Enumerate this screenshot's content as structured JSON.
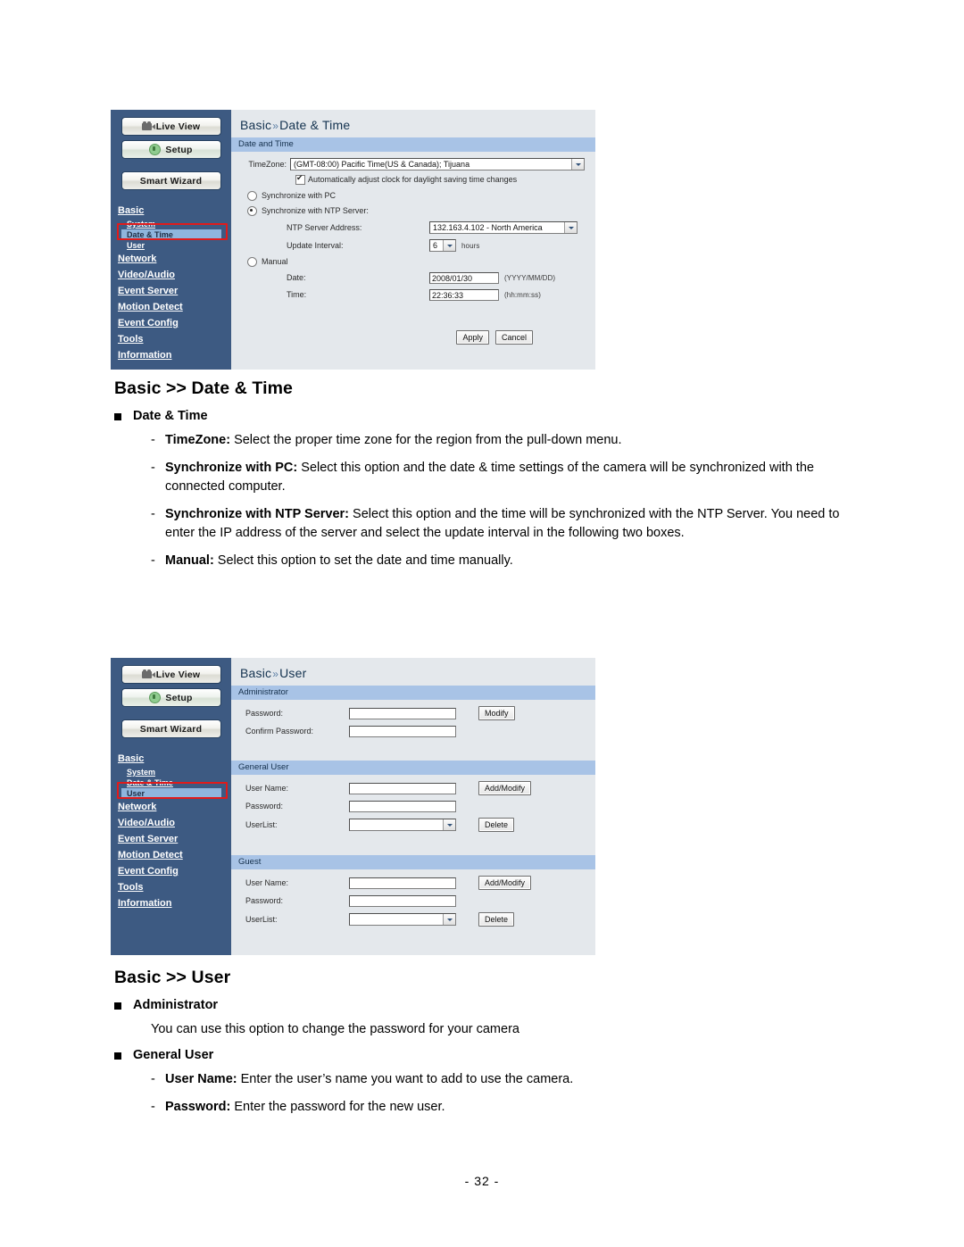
{
  "page": {
    "number_label": "- 32 -"
  },
  "screenshot_datetime": {
    "sidebar": {
      "buttons": [
        {
          "label": "Live View",
          "icon": "camera-icon"
        },
        {
          "label": "Setup",
          "icon": "gear-icon"
        },
        {
          "label": "Smart Wizard",
          "icon": "none"
        }
      ],
      "nav": [
        {
          "label": "Basic",
          "level": "top"
        },
        {
          "label": "System",
          "level": "sub"
        },
        {
          "label": "Date & Time",
          "level": "sub",
          "active": true
        },
        {
          "label": "User",
          "level": "sub"
        },
        {
          "label": "Network",
          "level": "top"
        },
        {
          "label": "Video/Audio",
          "level": "top"
        },
        {
          "label": "Event Server",
          "level": "top"
        },
        {
          "label": "Motion Detect",
          "level": "top"
        },
        {
          "label": "Event Config",
          "level": "top"
        },
        {
          "label": "Tools",
          "level": "top"
        },
        {
          "label": "Information",
          "level": "top"
        }
      ]
    },
    "title_prefix": "Basic",
    "title_chev": "»",
    "title_main": "Date & Time",
    "section_bar": "Date and Time",
    "timezone_label": "TimeZone:",
    "timezone_value": "(GMT-08:00) Pacific Time(US & Canada); Tijuana",
    "dst_checkbox_label": "Automatically adjust clock for daylight saving time changes",
    "dst_checked": true,
    "sync_pc_label": "Synchronize with PC",
    "sync_pc_selected": false,
    "sync_ntp_label": "Synchronize with NTP Server:",
    "sync_ntp_selected": true,
    "ntp_address_label": "NTP Server Address:",
    "ntp_address_value": "132.163.4.102 - North America",
    "update_interval_label": "Update Interval:",
    "update_interval_value": "6",
    "update_interval_unit": "hours",
    "manual_label": "Manual",
    "manual_selected": false,
    "date_label": "Date:",
    "date_value": "2008/01/30",
    "date_hint": "(YYYY/MM/DD)",
    "time_label": "Time:",
    "time_value": "22:36:33",
    "time_hint": "(hh:mm:ss)",
    "apply_label": "Apply",
    "cancel_label": "Cancel"
  },
  "screenshot_user": {
    "sidebar": {
      "buttons": [
        {
          "label": "Live View",
          "icon": "camera-icon"
        },
        {
          "label": "Setup",
          "icon": "gear-icon"
        },
        {
          "label": "Smart Wizard",
          "icon": "none"
        }
      ],
      "nav": [
        {
          "label": "Basic",
          "level": "top"
        },
        {
          "label": "System",
          "level": "sub"
        },
        {
          "label": "Date & Time",
          "level": "sub"
        },
        {
          "label": "User",
          "level": "sub",
          "active": true
        },
        {
          "label": "Network",
          "level": "top"
        },
        {
          "label": "Video/Audio",
          "level": "top"
        },
        {
          "label": "Event Server",
          "level": "top"
        },
        {
          "label": "Motion Detect",
          "level": "top"
        },
        {
          "label": "Event Config",
          "level": "top"
        },
        {
          "label": "Tools",
          "level": "top"
        },
        {
          "label": "Information",
          "level": "top"
        }
      ]
    },
    "title_prefix": "Basic",
    "title_chev": "»",
    "title_main": "User",
    "admin": {
      "bar": "Administrator",
      "password_label": "Password:",
      "password_value": "",
      "confirm_label": "Confirm Password:",
      "confirm_value": "",
      "modify_label": "Modify"
    },
    "general": {
      "bar": "General User",
      "username_label": "User Name:",
      "username_value": "",
      "password_label": "Password:",
      "password_value": "",
      "userlist_label": "UserList:",
      "userlist_value": "",
      "add_modify_label": "Add/Modify",
      "delete_label": "Delete"
    },
    "guest": {
      "bar": "Guest",
      "username_label": "User Name:",
      "username_value": "",
      "password_label": "Password:",
      "password_value": "",
      "userlist_label": "UserList:",
      "userlist_value": "",
      "add_modify_label": "Add/Modify",
      "delete_label": "Delete"
    }
  },
  "doc_datetime": {
    "heading": "Basic >> Date & Time",
    "section_title": "Date & Time",
    "items": [
      {
        "term": "TimeZone:",
        "text": " Select the proper time zone for the region from the pull-down menu."
      },
      {
        "term": "Synchronize with PC:",
        "text": " Select this option and the date & time settings of the camera will be synchronized with the connected computer."
      },
      {
        "term": "Synchronize with NTP Server:",
        "text": " Select this option and the time will be synchronized with the NTP Server. You need to enter the IP address of the server and select the update interval in the following two boxes."
      },
      {
        "term": "Manual:",
        "text": " Select this option to set the date and time manually."
      }
    ]
  },
  "doc_user": {
    "heading": "Basic >> User",
    "admin_title": "Administrator",
    "admin_text": "You can use this option to change the password for your camera",
    "general_title": "General User",
    "general_items": [
      {
        "term": "User Name:",
        "text": " Enter the user’s name you want to add to use the camera."
      },
      {
        "term": "Password:",
        "text": " Enter the password for the new user."
      }
    ]
  },
  "colors": {
    "sidebar_bg": "#3d5a82",
    "content_bg": "#e4e8ec",
    "section_bar": "#a8c3e6",
    "highlight": "#8fb5dd",
    "redbox": "#e01b1b",
    "title": "#13324f"
  }
}
